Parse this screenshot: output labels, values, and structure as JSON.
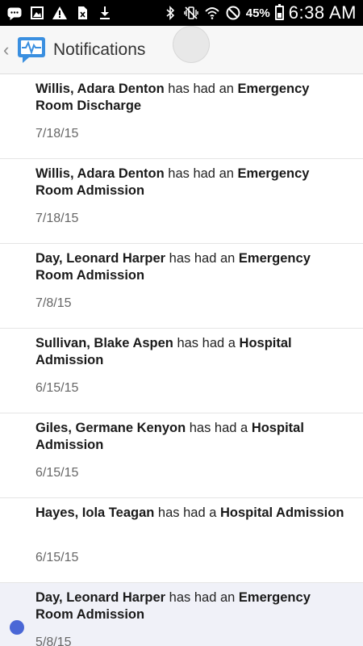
{
  "status_bar": {
    "battery": "45%",
    "time": "6:38 AM",
    "icons": [
      "messages-icon",
      "gallery-icon",
      "warning-icon",
      "no-sim-icon",
      "download-icon",
      "bluetooth-icon",
      "vibrate-icon",
      "wifi-icon",
      "do-not-disturb-icon",
      "battery-icon"
    ]
  },
  "app_bar": {
    "title": "Notifications",
    "back_icon": "chevron-left-icon",
    "logo_icon": "heartbeat-chat-icon"
  },
  "notifications": [
    {
      "name": "Willis, Adara Denton",
      "connector": " has had an ",
      "event": "Emergency Room Discharge",
      "date": "7/18/15",
      "unread": false
    },
    {
      "name": "Willis, Adara Denton",
      "connector": " has had an ",
      "event": "Emergency Room Admission",
      "date": "7/18/15",
      "unread": false
    },
    {
      "name": "Day, Leonard Harper",
      "connector": " has had an ",
      "event": "Emergency Room Admission",
      "date": "7/8/15",
      "unread": false
    },
    {
      "name": "Sullivan, Blake Aspen",
      "connector": " has had a ",
      "event": "Hospital Admission",
      "date": "6/15/15",
      "unread": false
    },
    {
      "name": "Giles, Germane Kenyon",
      "connector": " has had a ",
      "event": "Hospital Admission",
      "date": "6/15/15",
      "unread": false
    },
    {
      "name": "Hayes, Iola Teagan",
      "connector": " has had a ",
      "event": "Hospital Admission",
      "date": "6/15/15",
      "unread": false
    },
    {
      "name": "Day, Leonard Harper",
      "connector": " has had an ",
      "event": "Emergency Room Admission",
      "date": "5/8/15",
      "unread": true
    }
  ],
  "colors": {
    "unread_dot": "#4a67d6",
    "unread_background": "#f0f1f8",
    "logo_blue": "#3a8fe0"
  }
}
